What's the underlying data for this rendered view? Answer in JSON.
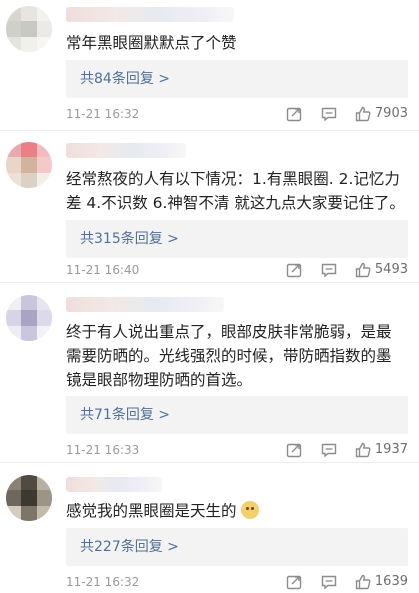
{
  "comments": [
    {
      "text_lines": [
        "常年黑眼圈默默点了个赞"
      ],
      "replies": "共84条回复 >",
      "time": "11-21 16:32",
      "likes": "7903",
      "avatar_colors": [
        "#d9d6cf",
        "#e8e4de",
        "#f4f2ee",
        "#cfd0c8",
        "#c8c9c2",
        "#eceae6",
        "#e5e3dd",
        "#f1f0ec",
        "#f7f6f3"
      ]
    },
    {
      "text_lines": [
        "经常熬夜的人有以下情况：1.有黑眼圈. 2.记忆力",
        "差 4.不识数 6.神智不清  就这九点大家要记住了。"
      ],
      "replies": "共315条回复 >",
      "time": "11-21 16:40",
      "likes": "5493",
      "avatar_colors": [
        "#e9a9ae",
        "#ea7f85",
        "#f2bcbf",
        "#e8d7c9",
        "#d2b39b",
        "#f4c9c9",
        "#efe1d6",
        "#ddd0c4",
        "#f3eee9"
      ]
    },
    {
      "text_lines": [
        "终于有人说出重点了，眼部皮肤非常脆弱，是最",
        "需要防晒的。光线强烈的时候，带防晒指数的墨",
        "镜是眼部物理防晒的首选。"
      ],
      "replies": "共71条回复 >",
      "time": "11-21 16:33",
      "likes": "1937",
      "avatar_colors": [
        "#f1eff6",
        "#c7c6dc",
        "#e6e5ef",
        "#d8d4e6",
        "#a8a5c4",
        "#dcd9ea",
        "#eeedf4",
        "#c9c6dd",
        "#f3f2f7"
      ]
    },
    {
      "text_lines": [
        "感觉我的黑眼圈是天生的"
      ],
      "replies": "共227条回复 >",
      "time": "11-21 16:32",
      "likes": "1639",
      "avatar_colors": [
        "#8a8274",
        "#4f4a42",
        "#b8b0a2",
        "#6f675b",
        "#3c3832",
        "#9c9486",
        "#d4cdbf",
        "#7d7567",
        "#c2baac"
      ]
    }
  ]
}
